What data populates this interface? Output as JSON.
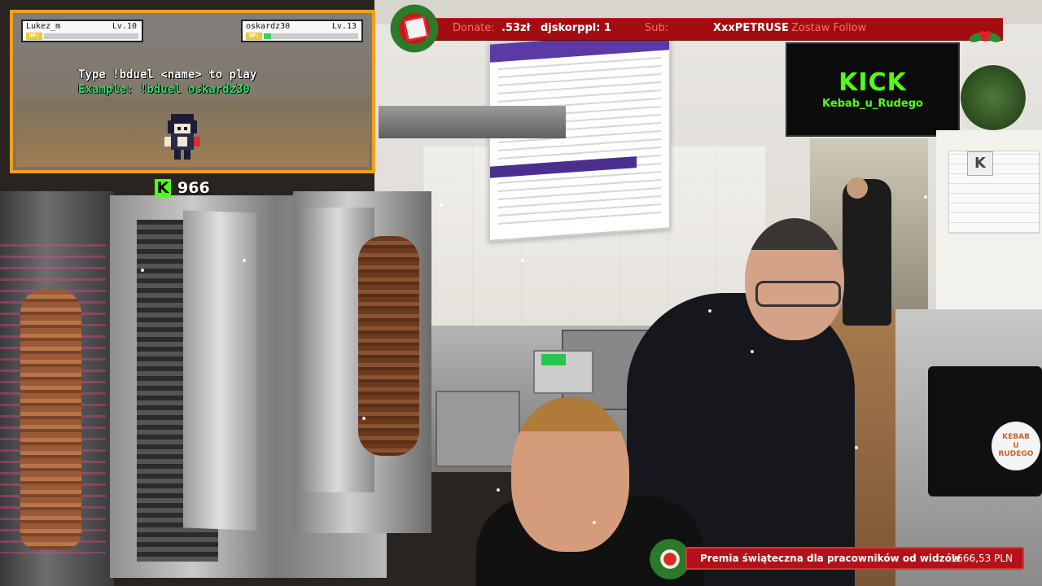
{
  "game": {
    "player1": {
      "name": "Lukez_m",
      "level": "Lv.10",
      "hp_label": "HP:",
      "hp_fraction": 0.0
    },
    "player2": {
      "name": "oskardz30",
      "level": "Lv.13",
      "hp_label": "HP:",
      "hp_fraction": 0.08
    },
    "instruction": "Type !bduel <name> to play",
    "example": "Example: !bduel oskardz30"
  },
  "kick_counter": {
    "icon": "kick-logo-icon",
    "icon_letter": "K",
    "value": "966"
  },
  "ticker": {
    "donate_label": "Donate:",
    "donate_amount": ".53zł",
    "donate_user": "djskorppl: 1",
    "sub_label": "Sub:",
    "sub_user": "XxxPETRUSE",
    "follow_label": "Zostaw Follow"
  },
  "tv": {
    "brand": "KICK",
    "channel": "Kebab_u_Rudego"
  },
  "sticker": {
    "line1": "KEBAB",
    "line2": "U",
    "line3": "RUDEGO"
  },
  "sign": {
    "letter": "K"
  },
  "bottom_bar": {
    "message": "Premia świąteczna dla pracowników od widzów",
    "amount": "1666,53 PLN"
  },
  "colors": {
    "kick_green": "#53fc18",
    "game_border": "#f0a020",
    "ticker_red": "#a30d12",
    "bottom_red": "#b3121a"
  }
}
